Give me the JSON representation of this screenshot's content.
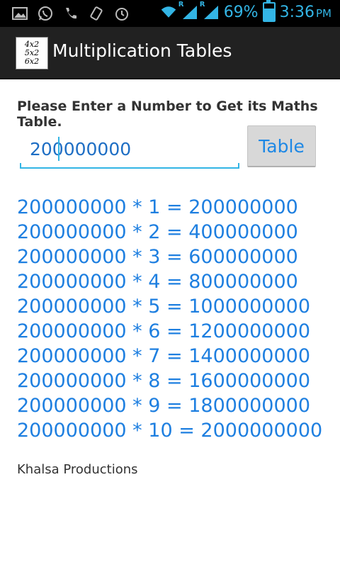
{
  "status_bar": {
    "battery_percent": "69%",
    "battery_level": 0.69,
    "time": "3:36",
    "ampm": "PM",
    "network_tag_1": "R",
    "network_tag_2": "R",
    "icons": [
      "gallery-icon",
      "whatsapp-icon",
      "phone-icon",
      "vibrate-icon",
      "alarm-icon",
      "wifi-icon",
      "signal-icon",
      "signal-icon",
      "battery-icon"
    ],
    "accent": "#33b5e5"
  },
  "action_bar": {
    "title": "Multiplication Tables",
    "icon_lines": [
      "4x2",
      "5x2",
      "6x2"
    ],
    "background": "#212121"
  },
  "form": {
    "prompt": "Please Enter a Number to Get its Maths Table.",
    "input_value": "200000000",
    "button_label": "Table"
  },
  "results": [
    "200000000 * 1 = 200000000",
    "200000000 * 2 = 400000000",
    "200000000 * 3 = 600000000",
    "200000000 * 4 = 800000000",
    "200000000 * 5 = 1000000000",
    "200000000 * 6 = 1200000000",
    "200000000 * 7 = 1400000000",
    "200000000 * 8 = 1600000000",
    "200000000 * 9 = 1800000000",
    "200000000 * 10 = 2000000000"
  ],
  "footer": "Khalsa Productions",
  "colors": {
    "result_text": "#1e7fe0",
    "button_bg": "#d8d8d8"
  }
}
